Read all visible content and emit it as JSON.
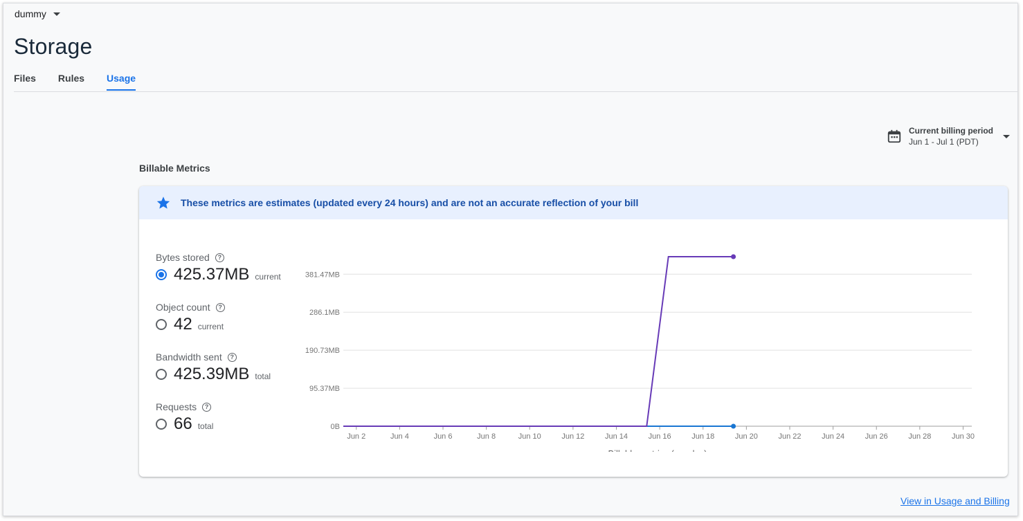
{
  "project": {
    "name": "dummy"
  },
  "page": {
    "title": "Storage"
  },
  "tabs": [
    {
      "label": "Files"
    },
    {
      "label": "Rules"
    },
    {
      "label": "Usage"
    }
  ],
  "active_tab": "Usage",
  "billing_period": {
    "title": "Current billing period",
    "range": "Jun 1 - Jul 1 (PDT)"
  },
  "section": {
    "title": "Billable Metrics"
  },
  "notice": {
    "text": "These metrics are estimates (updated every 24 hours) and are not an accurate reflection of your bill"
  },
  "metrics": [
    {
      "label": "Bytes stored",
      "value": "425.37MB",
      "unit": "current",
      "selected": true
    },
    {
      "label": "Object count",
      "value": "42",
      "unit": "current",
      "selected": false
    },
    {
      "label": "Bandwidth sent",
      "value": "425.39MB",
      "unit": "total",
      "selected": false
    },
    {
      "label": "Requests",
      "value": "66",
      "unit": "total",
      "selected": false
    }
  ],
  "footer": {
    "link": "View in Usage and Billing"
  },
  "colors": {
    "accent": "#1a73e8",
    "series_primary": "#673ab7",
    "series_secondary": "#1976d2"
  },
  "chart_data": {
    "type": "line",
    "xlabel": "Billable metrics (per day)",
    "ylabel": "",
    "x_ticks": [
      "Jun 2",
      "Jun 4",
      "Jun 6",
      "Jun 8",
      "Jun 10",
      "Jun 12",
      "Jun 14",
      "Jun 16",
      "Jun 18",
      "Jun 20",
      "Jun 22",
      "Jun 24",
      "Jun 26",
      "Jun 28",
      "Jun 30"
    ],
    "x_tick_days": [
      2,
      4,
      6,
      8,
      10,
      12,
      14,
      16,
      18,
      20,
      22,
      24,
      26,
      28,
      30
    ],
    "xlim": [
      1.4,
      30.4
    ],
    "y_ticks": [
      "0B",
      "95.37MB",
      "190.73MB",
      "286.1MB",
      "381.47MB"
    ],
    "y_tick_values": [
      0,
      95.37,
      190.73,
      286.1,
      381.47
    ],
    "ylim": [
      0,
      425.37
    ],
    "grid": true,
    "series": [
      {
        "points": [
          {
            "x": 1.4,
            "y": 0
          },
          {
            "x": 15.4,
            "y": 0
          },
          {
            "x": 16.4,
            "y": 425.37
          },
          {
            "x": 19.4,
            "y": 425.37
          }
        ]
      },
      {
        "points": [
          {
            "x": 1.4,
            "y": 0
          },
          {
            "x": 19.4,
            "y": 0
          }
        ]
      }
    ]
  }
}
